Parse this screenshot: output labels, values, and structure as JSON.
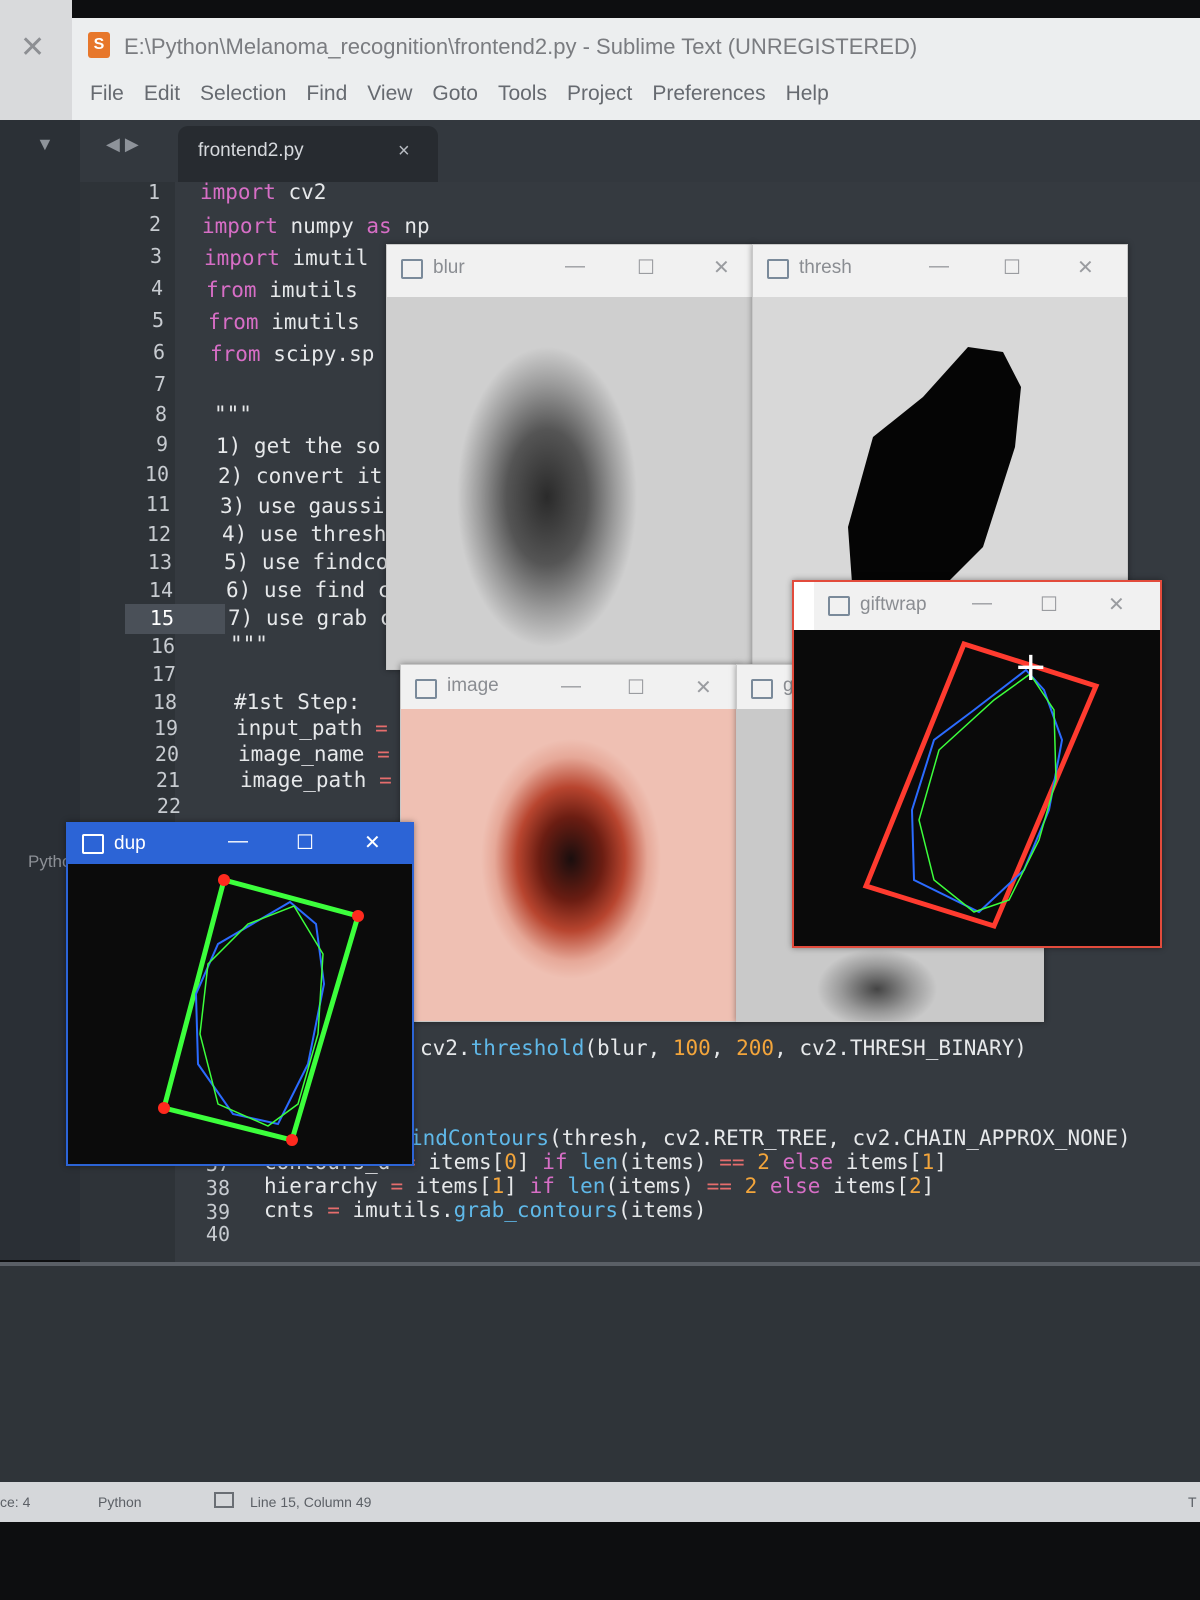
{
  "window": {
    "title": "E:\\Python\\Melanoma_recognition\\frontend2.py - Sublime Text (UNREGISTERED)",
    "close_glyph": "✕"
  },
  "menu": [
    "File",
    "Edit",
    "Selection",
    "Find",
    "View",
    "Goto",
    "Tools",
    "Project",
    "Preferences",
    "Help"
  ],
  "tab": {
    "label": "frontend2.py",
    "close": "×"
  },
  "editor": {
    "lines": [
      {
        "n": "1",
        "text": "import cv2"
      },
      {
        "n": "2",
        "text": "import numpy as np"
      },
      {
        "n": "3",
        "text": "import imutil"
      },
      {
        "n": "4",
        "text": "from imutils"
      },
      {
        "n": "5",
        "text": "from imutils"
      },
      {
        "n": "6",
        "text": "from scipy.sp"
      },
      {
        "n": "7",
        "text": ""
      },
      {
        "n": "8",
        "text": "\"\"\""
      },
      {
        "n": "9",
        "text": "1) get the so"
      },
      {
        "n": "10",
        "text": "2) convert it"
      },
      {
        "n": "11",
        "text": "3) use gaussi"
      },
      {
        "n": "12",
        "text": "4) use thresh"
      },
      {
        "n": "13",
        "text": "5) use findco"
      },
      {
        "n": "14",
        "text": "6) use find c"
      },
      {
        "n": "15",
        "text": "7) use grab c"
      },
      {
        "n": "16",
        "text": "\"\"\""
      },
      {
        "n": "17",
        "text": ""
      },
      {
        "n": "18",
        "text": "#1st Step:"
      },
      {
        "n": "19",
        "text": "input_path ="
      },
      {
        "n": "20",
        "text": "image_name ="
      },
      {
        "n": "21",
        "text": "image_path ="
      },
      {
        "n": "22",
        "text": ""
      }
    ],
    "lower_lines": [
      {
        "n": "",
        "text": "cv2.threshold(blur, 100, 200, cv2.THRESH_BINARY)"
      },
      {
        "n": "",
        "text": "indContours(thresh, cv2.RETR_TREE, cv2.CHAIN_APPROX_NONE)"
      },
      {
        "n": "37",
        "text": "contours_d = items[0] if len(items) == 2 else items[1]"
      },
      {
        "n": "38",
        "text": "hierarchy = items[1] if len(items) == 2 else items[2]"
      },
      {
        "n": "39",
        "text": "cnts = imutils.grab_contours(items)"
      },
      {
        "n": "40",
        "text": ""
      }
    ]
  },
  "cv_windows": {
    "blur": "blur",
    "thresh": "thresh",
    "giftwrap": "giftwrap",
    "image": "image",
    "gray": "gra",
    "dup": "dup"
  },
  "left_tabs": {
    "python": "Pytho"
  },
  "status": {
    "left": "ce: 4",
    "syntax": "Python",
    "position": "Line 15, Column 49",
    "right": "T"
  },
  "colors": {
    "editor_bg": "#353a40",
    "keyword": "#d76ec6",
    "function": "#5fb8e8",
    "number": "#f3a53b",
    "dup_title": "#2c64d6"
  }
}
